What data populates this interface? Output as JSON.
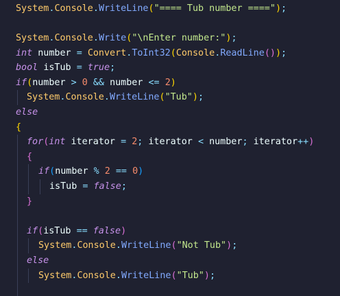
{
  "colors": {
    "background": "#1f2130",
    "class": "#ffcb6b",
    "method": "#82aaff",
    "string": "#c3e88d",
    "keyword": "#c792ea",
    "number": "#f78c6c",
    "operator": "#89ddff",
    "bracket_gold": "#ffd700",
    "bracket_purple": "#da70d6",
    "bracket_blue": "#179fff"
  },
  "tokens": {
    "system": "System",
    "dot": ".",
    "console": "Console",
    "writeline": "WriteLine",
    "write": "Write",
    "lparen": "(",
    "rparen": ")",
    "semicolon": ";",
    "title_string": "\"==== Tub number ====\"",
    "prompt_string": "\"\\nEnter number:\"",
    "kw_int": "int",
    "kw_bool": "bool",
    "kw_true": "true",
    "kw_false": "false",
    "kw_if": "if",
    "kw_else": "else",
    "kw_for": "for",
    "var_number": "number",
    "var_isTub": "isTub",
    "var_iterator": "iterator",
    "op_assign": "=",
    "op_gt": ">",
    "op_lt": "<",
    "op_le": "<=",
    "op_and": "&&",
    "op_eq": "==",
    "op_mod": "%",
    "op_inc": "++",
    "num_0": "0",
    "num_2": "2",
    "convert": "Convert",
    "toint32": "ToInt32",
    "readline": "ReadLine",
    "tub_string": "\"Tub\"",
    "not_tub_string": "\"Not Tub\"",
    "lbrace": "{",
    "rbrace": "}"
  }
}
